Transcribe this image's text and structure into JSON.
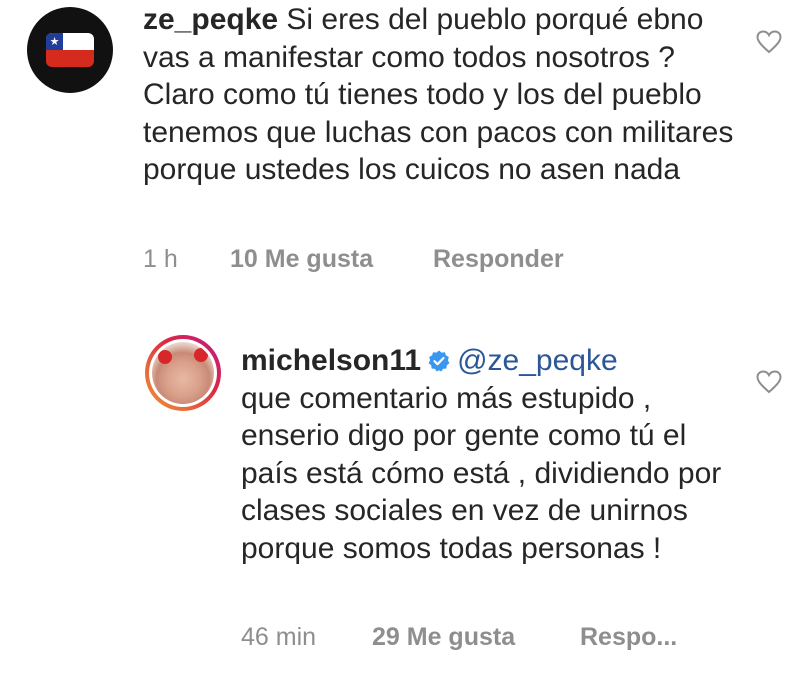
{
  "comments": [
    {
      "username": "ze_peqke",
      "avatar_icon": "chile-flag-icon",
      "text": "Si eres del pueblo porqué ebno vas a manifestar como todos nosotros ? Claro como tú tienes todo y los del pueblo tenemos que luchas con pacos con militares porque ustedes los cuicos no asen nada",
      "time": "1 h",
      "likes": "10 Me gusta",
      "reply": "Responder"
    },
    {
      "username": "michelson11",
      "verified": true,
      "mention": "@ze_peqke",
      "text": "que comentario más estupido , enserio digo por gente como tú el país está cómo está , dividiendo por clases sociales en vez de unirnos porque somos todas personas !",
      "time": "46 min",
      "likes": "29 Me gusta",
      "reply": "Respo..."
    }
  ],
  "colors": {
    "text": "#262626",
    "muted": "#8e8e8e",
    "mention": "#2b5797",
    "verified": "#3897f0"
  }
}
